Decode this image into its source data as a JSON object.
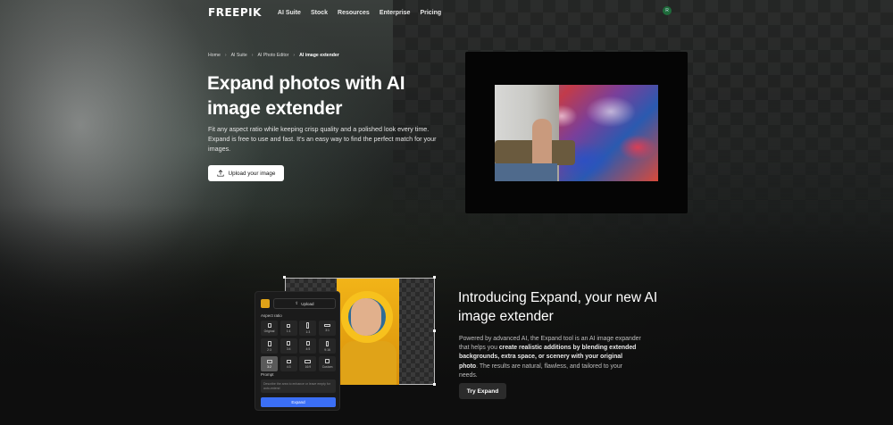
{
  "nav": {
    "logo": "FREEPIK",
    "items": [
      "AI Suite",
      "Stock",
      "Resources",
      "Enterprise",
      "Pricing"
    ],
    "avatar_initial": "R"
  },
  "breadcrumb": [
    "Home",
    "AI Suite",
    "AI Photo Editor",
    "AI image extender"
  ],
  "hero": {
    "title": "Expand photos with AI image extender",
    "description": "Fit any aspect ratio while keeping crisp quality and a polished look every time. Expand is free to use and fast. It's an easy way to find the perfect match for your images.",
    "upload_label": "Upload your image"
  },
  "editor": {
    "upload_label": "Upload",
    "aspect_ratio_label": "Aspect ratio",
    "ratios": [
      "Original",
      "1:1",
      "1:3",
      "3:1",
      "2:3",
      "3:4",
      "4:5",
      "9:16",
      "3:2",
      "4:3",
      "16:9",
      "Custom"
    ],
    "selected_ratio": "3:2",
    "prompt_label": "Prompt",
    "prompt_placeholder": "Describe the area to enhance or leave empty for auto-extend",
    "expand_label": "Expand"
  },
  "intro": {
    "title": "Introducing Expand, your new AI image extender",
    "description_pre": "Powered by advanced AI, the Expand tool is an AI image expander that helps you ",
    "description_bold": "create realistic additions by blending extended backgrounds, extra space, or scenery with your original photo",
    "description_post": ". The results are natural, flawless, and tailored to your needs.",
    "button_label": "Try Expand"
  },
  "colors": {
    "accent_blue": "#3b6ff5",
    "primary_button": "#ffffff",
    "background": "#0e0e0e"
  }
}
